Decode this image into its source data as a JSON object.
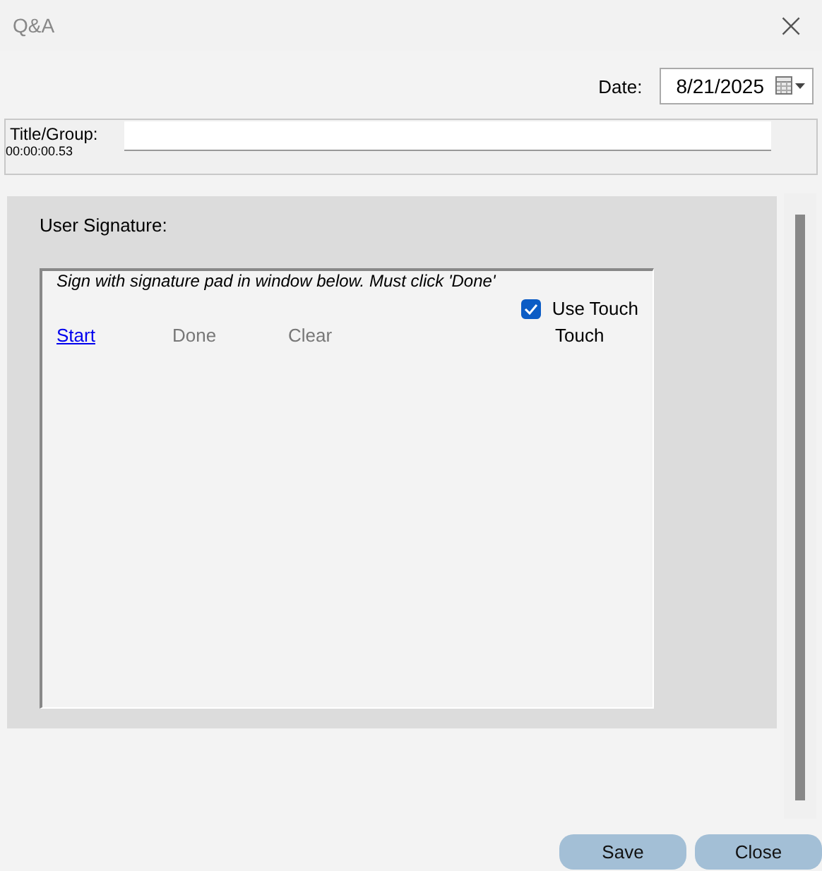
{
  "window": {
    "title": "Q&A",
    "close": "×"
  },
  "date": {
    "label": "Date:",
    "value": "8/21/2025"
  },
  "title_group": {
    "label": "Title/Group:",
    "elapsed": "00:00:00.53"
  },
  "signature": {
    "heading": "User Signature:",
    "instructions": "Sign with signature pad in window below. Must click 'Done'",
    "use_touch": {
      "label": "Use Touch",
      "checked": true
    },
    "actions": [
      {
        "label": "Start",
        "disabled": false
      },
      {
        "label": "Done",
        "disabled": true
      },
      {
        "label": "Clear",
        "disabled": true
      }
    ],
    "mode": "Touch"
  },
  "buttons": [
    "Save",
    "Close"
  ]
}
